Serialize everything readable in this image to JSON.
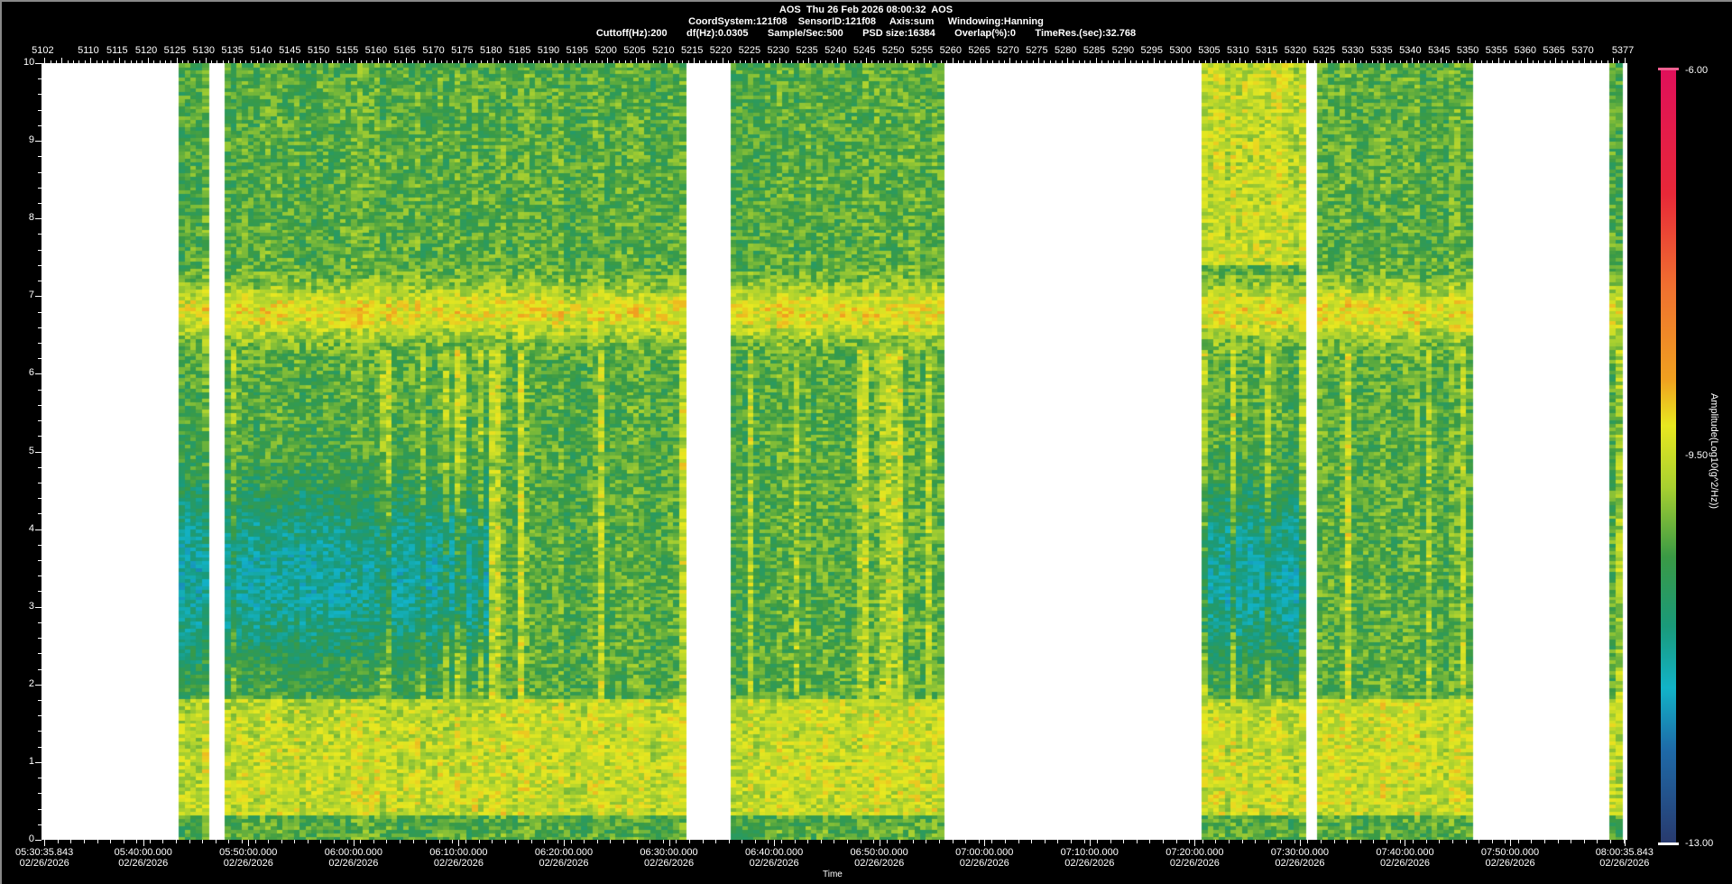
{
  "header": {
    "line1": "AOS  Thu 26 Feb 2026 08:00:32  AOS",
    "line2": "CoordSystem:121f08    SensorID:121f08     Axis:sum     Windowing:Hanning",
    "line3": "Cuttoff(Hz):200       df(Hz):0.0305       Sample/Sec:500       PSD size:16384       Overlap(%):0       TimeRes.(sec):32.768"
  },
  "chart_data": {
    "type": "heatmap",
    "title": "AOS  Thu 26 Feb 2026 08:00:32  AOS",
    "xlabel": "Time",
    "ylabel": "",
    "colorbar_label": "Amplitude(Log10(g^2/Hz))",
    "index_range": [
      5102,
      5377
    ],
    "top_tick_labels": [
      "5102",
      "5110",
      "5115",
      "5120",
      "5125",
      "5130",
      "5135",
      "5140",
      "5145",
      "5150",
      "5155",
      "5160",
      "5165",
      "5170",
      "5175",
      "5180",
      "5185",
      "5190",
      "5195",
      "5200",
      "5205",
      "5210",
      "5215",
      "5220",
      "5225",
      "5230",
      "5235",
      "5240",
      "5245",
      "5250",
      "5255",
      "5260",
      "5265",
      "5270",
      "5275",
      "5280",
      "5285",
      "5290",
      "5295",
      "5300",
      "5305",
      "5310",
      "5315",
      "5320",
      "5325",
      "5330",
      "5335",
      "5340",
      "5345",
      "5350",
      "5355",
      "5360",
      "5365",
      "5370",
      "5377"
    ],
    "y_range_hz": [
      0,
      10
    ],
    "y_tick_labels": [
      "0",
      "1",
      "2",
      "3",
      "4",
      "5",
      "6",
      "7",
      "8",
      "9",
      "10"
    ],
    "x_time_labels": [
      {
        "time": "05:30:35.843",
        "date": "02/26/2026",
        "index": 5102
      },
      {
        "time": "05:40:00.000",
        "date": "02/26/2026",
        "index": 5119.2
      },
      {
        "time": "05:50:00.000",
        "date": "02/26/2026",
        "index": 5137.5
      },
      {
        "time": "06:00:00.000",
        "date": "02/26/2026",
        "index": 5155.8
      },
      {
        "time": "06:10:00.000",
        "date": "02/26/2026",
        "index": 5174.1
      },
      {
        "time": "06:20:00.000",
        "date": "02/26/2026",
        "index": 5192.4
      },
      {
        "time": "06:30:00.000",
        "date": "02/26/2026",
        "index": 5210.7
      },
      {
        "time": "06:40:00.000",
        "date": "02/26/2026",
        "index": 5229.0
      },
      {
        "time": "06:50:00.000",
        "date": "02/26/2026",
        "index": 5247.3
      },
      {
        "time": "07:00:00.000",
        "date": "02/26/2026",
        "index": 5265.6
      },
      {
        "time": "07:10:00.000",
        "date": "02/26/2026",
        "index": 5283.9
      },
      {
        "time": "07:20:00.000",
        "date": "02/26/2026",
        "index": 5302.2
      },
      {
        "time": "07:30:00.000",
        "date": "02/26/2026",
        "index": 5320.5
      },
      {
        "time": "07:40:00.000",
        "date": "02/26/2026",
        "index": 5338.8
      },
      {
        "time": "07:50:00.000",
        "date": "02/26/2026",
        "index": 5357.1
      },
      {
        "time": "08:00:35.843",
        "date": "02/26/2026",
        "index": 5377
      }
    ],
    "data_segments": [
      [
        5126,
        5131
      ],
      [
        5134,
        5214
      ],
      [
        5222,
        5259
      ],
      [
        5304,
        5322
      ],
      [
        5324,
        5351
      ],
      [
        5374.5,
        5377
      ]
    ],
    "color_range": [
      -13.0,
      -6.0
    ],
    "colorbar_labels": [
      "-6.00",
      "-9.50",
      "-13.00"
    ],
    "features": [
      {
        "band_hz": [
          6.4,
          7.2
        ],
        "level": -9.3
      },
      {
        "band_hz": [
          0.3,
          1.8
        ],
        "level": -9.5
      },
      {
        "band_hz": [
          2.3,
          5.5
        ],
        "level": -11.3
      }
    ]
  }
}
